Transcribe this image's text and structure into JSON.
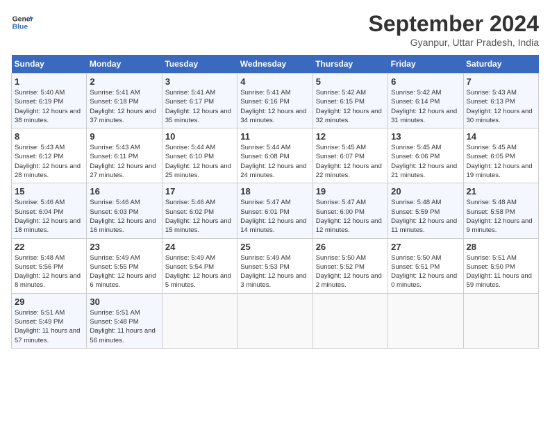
{
  "header": {
    "logo_line1": "General",
    "logo_line2": "Blue",
    "month": "September 2024",
    "location": "Gyanpur, Uttar Pradesh, India"
  },
  "weekdays": [
    "Sunday",
    "Monday",
    "Tuesday",
    "Wednesday",
    "Thursday",
    "Friday",
    "Saturday"
  ],
  "weeks": [
    [
      {
        "day": "1",
        "sunrise": "5:40 AM",
        "sunset": "6:19 PM",
        "daylight": "12 hours and 38 minutes."
      },
      {
        "day": "2",
        "sunrise": "5:41 AM",
        "sunset": "6:18 PM",
        "daylight": "12 hours and 37 minutes."
      },
      {
        "day": "3",
        "sunrise": "5:41 AM",
        "sunset": "6:17 PM",
        "daylight": "12 hours and 35 minutes."
      },
      {
        "day": "4",
        "sunrise": "5:41 AM",
        "sunset": "6:16 PM",
        "daylight": "12 hours and 34 minutes."
      },
      {
        "day": "5",
        "sunrise": "5:42 AM",
        "sunset": "6:15 PM",
        "daylight": "12 hours and 32 minutes."
      },
      {
        "day": "6",
        "sunrise": "5:42 AM",
        "sunset": "6:14 PM",
        "daylight": "12 hours and 31 minutes."
      },
      {
        "day": "7",
        "sunrise": "5:43 AM",
        "sunset": "6:13 PM",
        "daylight": "12 hours and 30 minutes."
      }
    ],
    [
      {
        "day": "8",
        "sunrise": "5:43 AM",
        "sunset": "6:12 PM",
        "daylight": "12 hours and 28 minutes."
      },
      {
        "day": "9",
        "sunrise": "5:43 AM",
        "sunset": "6:11 PM",
        "daylight": "12 hours and 27 minutes."
      },
      {
        "day": "10",
        "sunrise": "5:44 AM",
        "sunset": "6:10 PM",
        "daylight": "12 hours and 25 minutes."
      },
      {
        "day": "11",
        "sunrise": "5:44 AM",
        "sunset": "6:08 PM",
        "daylight": "12 hours and 24 minutes."
      },
      {
        "day": "12",
        "sunrise": "5:45 AM",
        "sunset": "6:07 PM",
        "daylight": "12 hours and 22 minutes."
      },
      {
        "day": "13",
        "sunrise": "5:45 AM",
        "sunset": "6:06 PM",
        "daylight": "12 hours and 21 minutes."
      },
      {
        "day": "14",
        "sunrise": "5:45 AM",
        "sunset": "6:05 PM",
        "daylight": "12 hours and 19 minutes."
      }
    ],
    [
      {
        "day": "15",
        "sunrise": "5:46 AM",
        "sunset": "6:04 PM",
        "daylight": "12 hours and 18 minutes."
      },
      {
        "day": "16",
        "sunrise": "5:46 AM",
        "sunset": "6:03 PM",
        "daylight": "12 hours and 16 minutes."
      },
      {
        "day": "17",
        "sunrise": "5:46 AM",
        "sunset": "6:02 PM",
        "daylight": "12 hours and 15 minutes."
      },
      {
        "day": "18",
        "sunrise": "5:47 AM",
        "sunset": "6:01 PM",
        "daylight": "12 hours and 14 minutes."
      },
      {
        "day": "19",
        "sunrise": "5:47 AM",
        "sunset": "6:00 PM",
        "daylight": "12 hours and 12 minutes."
      },
      {
        "day": "20",
        "sunrise": "5:48 AM",
        "sunset": "5:59 PM",
        "daylight": "12 hours and 11 minutes."
      },
      {
        "day": "21",
        "sunrise": "5:48 AM",
        "sunset": "5:58 PM",
        "daylight": "12 hours and 9 minutes."
      }
    ],
    [
      {
        "day": "22",
        "sunrise": "5:48 AM",
        "sunset": "5:56 PM",
        "daylight": "12 hours and 8 minutes."
      },
      {
        "day": "23",
        "sunrise": "5:49 AM",
        "sunset": "5:55 PM",
        "daylight": "12 hours and 6 minutes."
      },
      {
        "day": "24",
        "sunrise": "5:49 AM",
        "sunset": "5:54 PM",
        "daylight": "12 hours and 5 minutes."
      },
      {
        "day": "25",
        "sunrise": "5:49 AM",
        "sunset": "5:53 PM",
        "daylight": "12 hours and 3 minutes."
      },
      {
        "day": "26",
        "sunrise": "5:50 AM",
        "sunset": "5:52 PM",
        "daylight": "12 hours and 2 minutes."
      },
      {
        "day": "27",
        "sunrise": "5:50 AM",
        "sunset": "5:51 PM",
        "daylight": "12 hours and 0 minutes."
      },
      {
        "day": "28",
        "sunrise": "5:51 AM",
        "sunset": "5:50 PM",
        "daylight": "11 hours and 59 minutes."
      }
    ],
    [
      {
        "day": "29",
        "sunrise": "5:51 AM",
        "sunset": "5:49 PM",
        "daylight": "11 hours and 57 minutes."
      },
      {
        "day": "30",
        "sunrise": "5:51 AM",
        "sunset": "5:48 PM",
        "daylight": "11 hours and 56 minutes."
      },
      null,
      null,
      null,
      null,
      null
    ]
  ]
}
